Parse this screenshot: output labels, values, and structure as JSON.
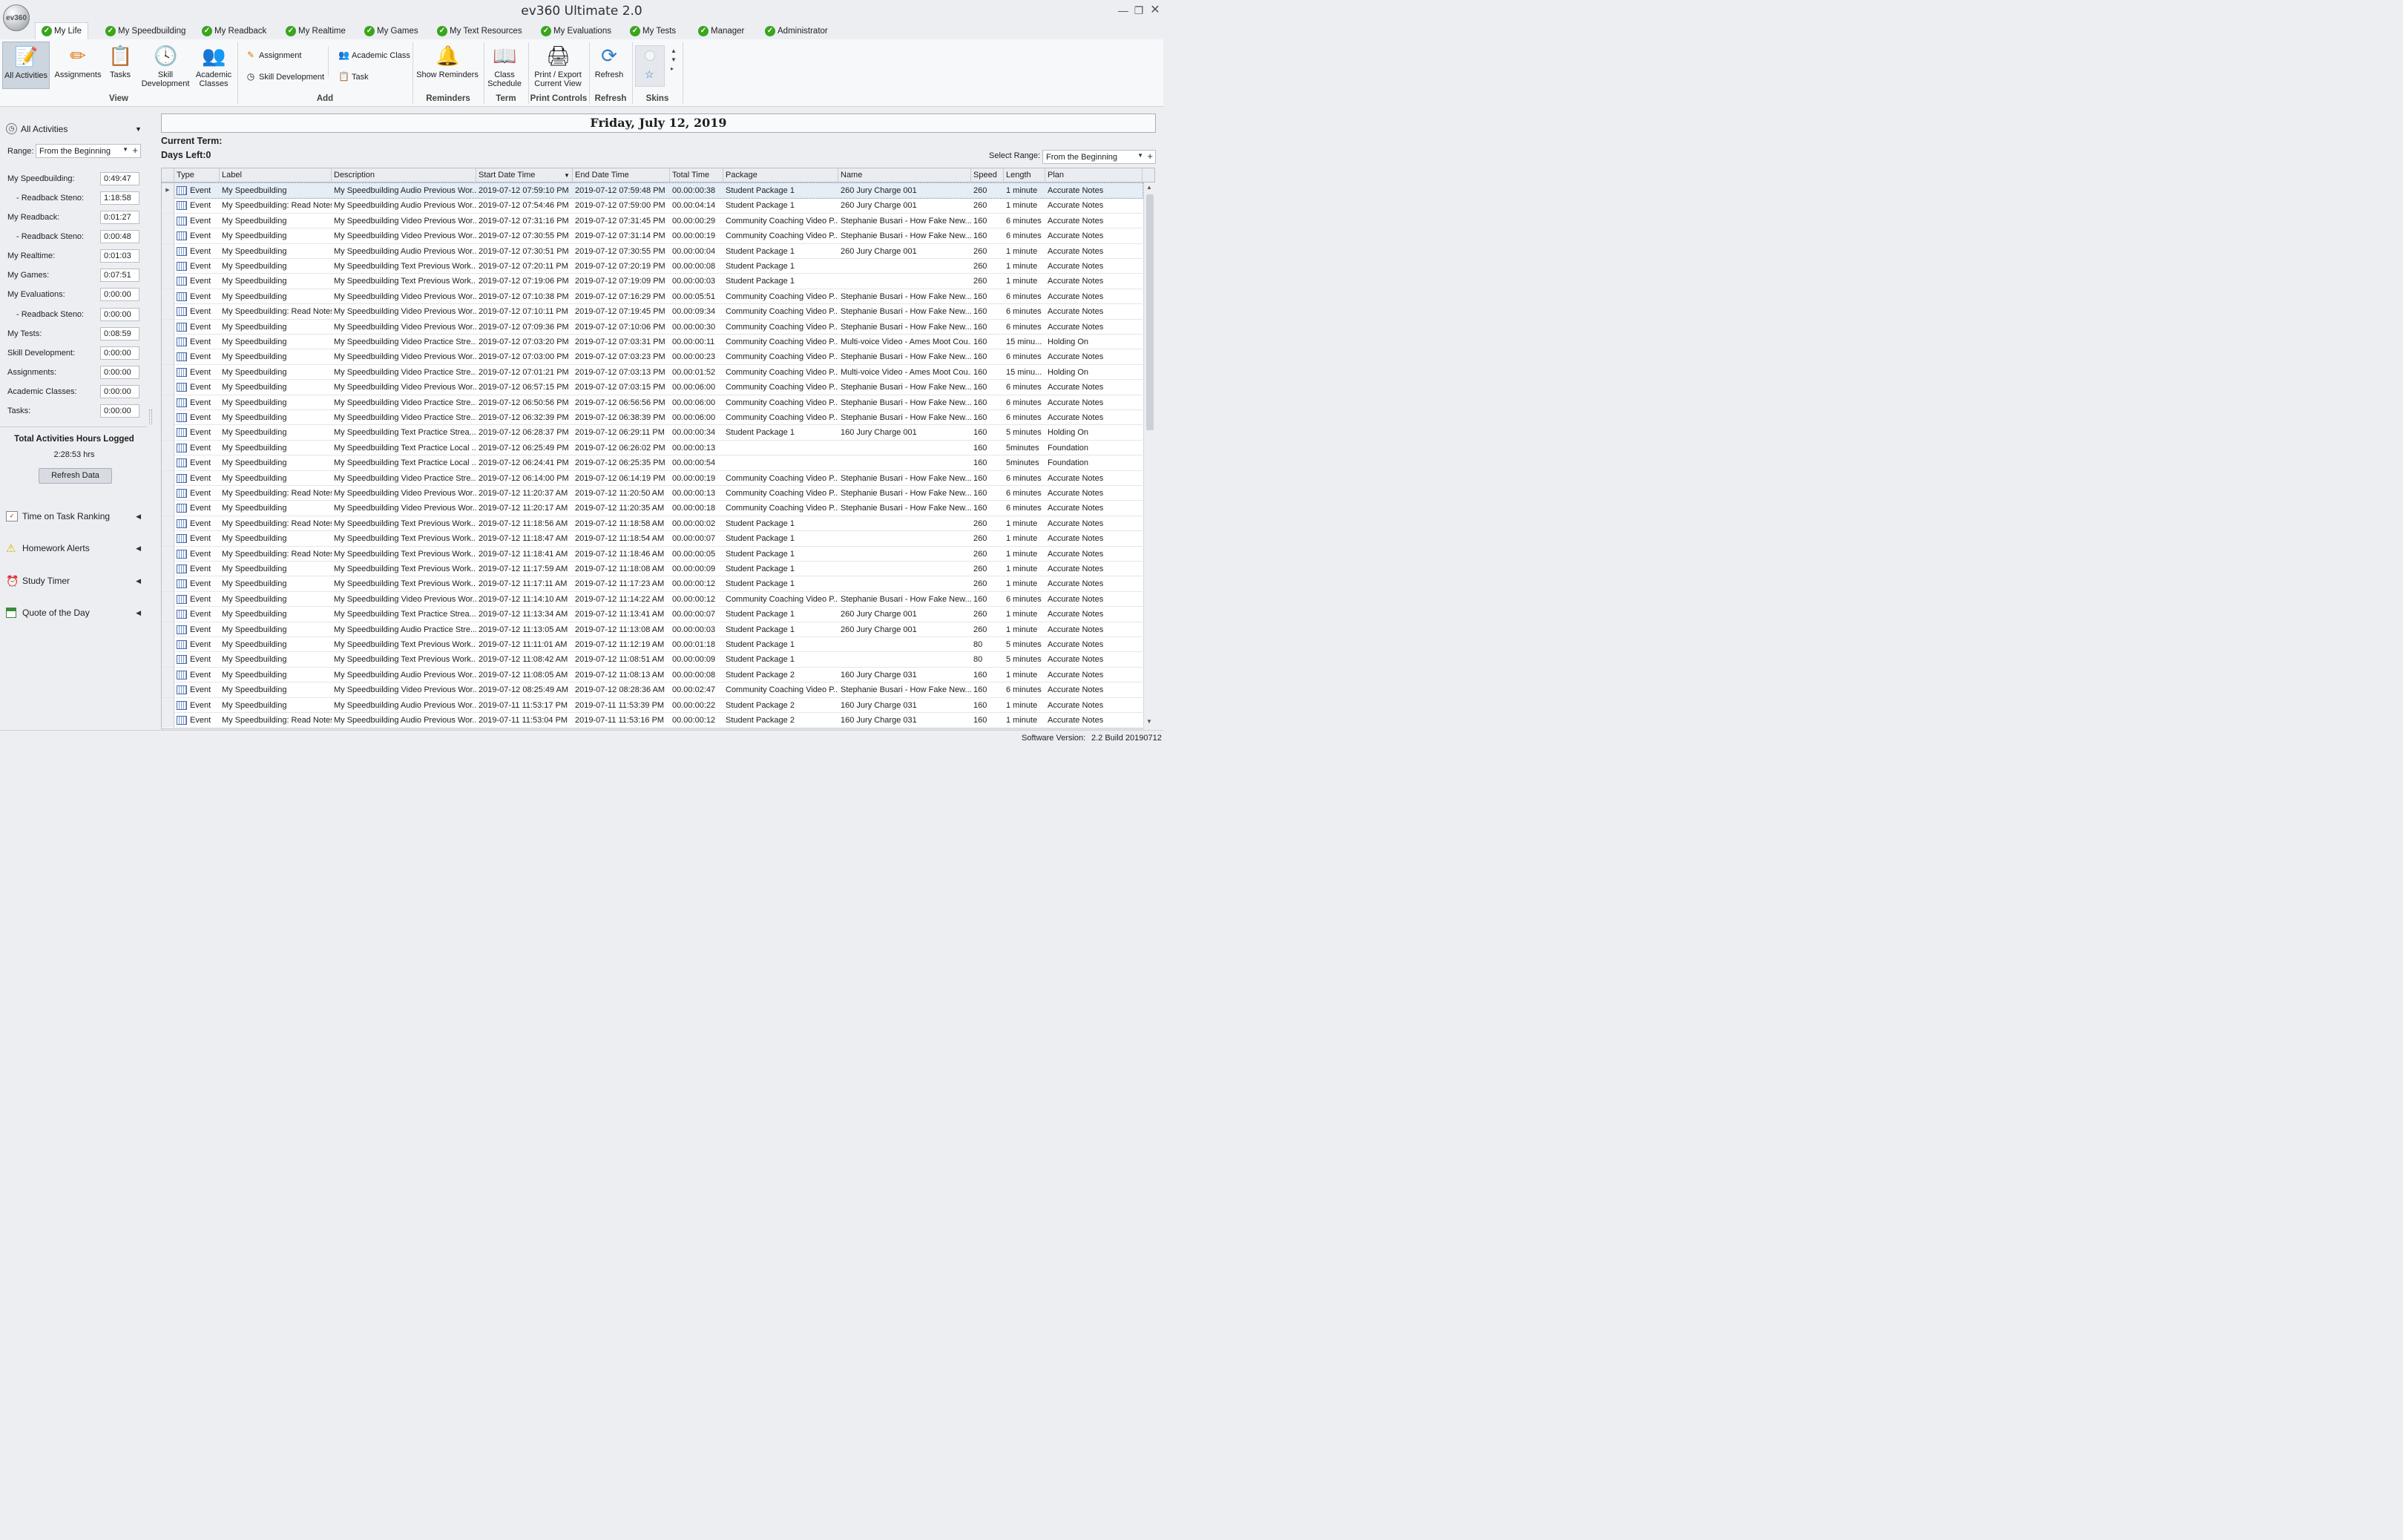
{
  "app": {
    "title": "ev360 Ultimate 2.0",
    "logo_text": "ev360"
  },
  "tabs": [
    "My Life",
    "My Speedbuilding",
    "My Readback",
    "My Realtime",
    "My Games",
    "My Text Resources",
    "My Evaluations",
    "My Tests",
    "Manager",
    "Administrator"
  ],
  "ribbon": {
    "view": {
      "label": "View",
      "all_activities": "All Activities",
      "assignments": "Assignments",
      "tasks": "Tasks",
      "skill_dev_1": "Skill",
      "skill_dev_2": "Development",
      "academic_1": "Academic",
      "academic_2": "Classes"
    },
    "add": {
      "label": "Add",
      "assignment": "Assignment",
      "skill_development": "Skill Development",
      "academic_class": "Academic Class",
      "task": "Task"
    },
    "reminders": {
      "label": "Reminders",
      "show": "Show Reminders"
    },
    "term": {
      "label": "Term",
      "class_1": "Class",
      "class_2": "Schedule"
    },
    "print": {
      "label": "Print Controls",
      "line1": "Print / Export",
      "line2": "Current View"
    },
    "refresh": {
      "label": "Refresh",
      "button": "Refresh"
    },
    "skins": {
      "label": "Skins"
    }
  },
  "sidebar": {
    "header": "All Activities",
    "range_label": "Range:",
    "range_value": "From the Beginning",
    "stats": [
      {
        "label": "My Speedbuilding:",
        "value": "0:49:47"
      },
      {
        "label": "- Readback Steno:",
        "value": "1:18:58"
      },
      {
        "label": "My Readback:",
        "value": "0:01:27"
      },
      {
        "label": "- Readback Steno:",
        "value": "0:00:48"
      },
      {
        "label": "My Realtime:",
        "value": "0:01:03"
      },
      {
        "label": "My Games:",
        "value": "0:07:51"
      },
      {
        "label": "My Evaluations:",
        "value": "0:00:00"
      },
      {
        "label": "- Readback Steno:",
        "value": "0:00:00"
      },
      {
        "label": "My Tests:",
        "value": "0:08:59"
      },
      {
        "label": "Skill Development:",
        "value": "0:00:00"
      },
      {
        "label": "Assignments:",
        "value": "0:00:00"
      },
      {
        "label": "Academic Classes:",
        "value": "0:00:00"
      },
      {
        "label": "Tasks:",
        "value": "0:00:00"
      }
    ],
    "total_label": "Total Activities Hours Logged",
    "total_value": "2:28:53 hrs",
    "refresh_button": "Refresh Data",
    "sections": [
      "Time on Task Ranking",
      "Homework Alerts",
      "Study Timer",
      "Quote of the Day"
    ]
  },
  "main": {
    "date": "Friday, July 12, 2019",
    "current_term": "Current Term:",
    "days_left": "Days Left:0",
    "select_range_label": "Select Range:",
    "select_range_value": "From the Beginning"
  },
  "grid": {
    "columns": [
      "Type",
      "Label",
      "Description",
      "Start Date Time",
      "End Date Time",
      "Total Time",
      "Package",
      "Name",
      "Speed",
      "Length",
      "Plan"
    ],
    "rows": [
      [
        "Event",
        "My Speedbuilding",
        "My Speedbuilding Audio Previous Wor...",
        "2019-07-12 07:59:10 PM",
        "2019-07-12 07:59:48 PM",
        "00.00:00:38",
        "Student Package 1",
        "260 Jury Charge 001",
        "260",
        "1 minute",
        "Accurate Notes"
      ],
      [
        "Event",
        "My Speedbuilding: Read Notes",
        "My Speedbuilding Audio Previous Wor...",
        "2019-07-12 07:54:46 PM",
        "2019-07-12 07:59:00 PM",
        "00.00:04:14",
        "Student Package 1",
        "260 Jury Charge 001",
        "260",
        "1 minute",
        "Accurate Notes"
      ],
      [
        "Event",
        "My Speedbuilding",
        "My Speedbuilding Video Previous Wor...",
        "2019-07-12 07:31:16 PM",
        "2019-07-12 07:31:45 PM",
        "00.00:00:29",
        "Community Coaching Video P...",
        "Stephanie Busari - How Fake New...",
        "160",
        "6 minutes",
        "Accurate Notes"
      ],
      [
        "Event",
        "My Speedbuilding",
        "My Speedbuilding Video Previous Wor...",
        "2019-07-12 07:30:55 PM",
        "2019-07-12 07:31:14 PM",
        "00.00:00:19",
        "Community Coaching Video P...",
        "Stephanie Busari - How Fake New...",
        "160",
        "6 minutes",
        "Accurate Notes"
      ],
      [
        "Event",
        "My Speedbuilding",
        "My Speedbuilding Audio Previous Wor...",
        "2019-07-12 07:30:51 PM",
        "2019-07-12 07:30:55 PM",
        "00.00:00:04",
        "Student Package 1",
        "260 Jury Charge 001",
        "260",
        "1 minute",
        "Accurate Notes"
      ],
      [
        "Event",
        "My Speedbuilding",
        "My Speedbuilding Text Previous Work...",
        "2019-07-12 07:20:11 PM",
        "2019-07-12 07:20:19 PM",
        "00.00:00:08",
        "Student Package 1",
        "",
        "260",
        "1 minute",
        "Accurate Notes"
      ],
      [
        "Event",
        "My Speedbuilding",
        "My Speedbuilding Text Previous Work...",
        "2019-07-12 07:19:06 PM",
        "2019-07-12 07:19:09 PM",
        "00.00:00:03",
        "Student Package 1",
        "",
        "260",
        "1 minute",
        "Accurate Notes"
      ],
      [
        "Event",
        "My Speedbuilding",
        "My Speedbuilding Video Previous Wor...",
        "2019-07-12 07:10:38 PM",
        "2019-07-12 07:16:29 PM",
        "00.00:05:51",
        "Community Coaching Video P...",
        "Stephanie Busari - How Fake New...",
        "160",
        "6 minutes",
        "Accurate Notes"
      ],
      [
        "Event",
        "My Speedbuilding: Read Notes",
        "My Speedbuilding Video Previous Wor...",
        "2019-07-12 07:10:11 PM",
        "2019-07-12 07:19:45 PM",
        "00.00:09:34",
        "Community Coaching Video P...",
        "Stephanie Busari - How Fake New...",
        "160",
        "6 minutes",
        "Accurate Notes"
      ],
      [
        "Event",
        "My Speedbuilding",
        "My Speedbuilding Video Previous Wor...",
        "2019-07-12 07:09:36 PM",
        "2019-07-12 07:10:06 PM",
        "00.00:00:30",
        "Community Coaching Video P...",
        "Stephanie Busari - How Fake New...",
        "160",
        "6 minutes",
        "Accurate Notes"
      ],
      [
        "Event",
        "My Speedbuilding",
        "My Speedbuilding Video Practice Stre...",
        "2019-07-12 07:03:20 PM",
        "2019-07-12 07:03:31 PM",
        "00.00:00:11",
        "Community Coaching Video P...",
        "Multi-voice Video - Ames Moot Cou...",
        "160",
        "15 minu...",
        "Holding On"
      ],
      [
        "Event",
        "My Speedbuilding",
        "My Speedbuilding Video Previous Wor...",
        "2019-07-12 07:03:00 PM",
        "2019-07-12 07:03:23 PM",
        "00.00:00:23",
        "Community Coaching Video P...",
        "Stephanie Busari - How Fake New...",
        "160",
        "6 minutes",
        "Accurate Notes"
      ],
      [
        "Event",
        "My Speedbuilding",
        "My Speedbuilding Video Practice Stre...",
        "2019-07-12 07:01:21 PM",
        "2019-07-12 07:03:13 PM",
        "00.00:01:52",
        "Community Coaching Video P...",
        "Multi-voice Video - Ames Moot Cou...",
        "160",
        "15 minu...",
        "Holding On"
      ],
      [
        "Event",
        "My Speedbuilding",
        "My Speedbuilding Video Previous Wor...",
        "2019-07-12 06:57:15 PM",
        "2019-07-12 07:03:15 PM",
        "00.00:06:00",
        "Community Coaching Video P...",
        "Stephanie Busari - How Fake New...",
        "160",
        "6 minutes",
        "Accurate Notes"
      ],
      [
        "Event",
        "My Speedbuilding",
        "My Speedbuilding Video Practice Stre...",
        "2019-07-12 06:50:56 PM",
        "2019-07-12 06:56:56 PM",
        "00.00:06:00",
        "Community Coaching Video P...",
        "Stephanie Busari - How Fake New...",
        "160",
        "6 minutes",
        "Accurate Notes"
      ],
      [
        "Event",
        "My Speedbuilding",
        "My Speedbuilding Video Practice Stre...",
        "2019-07-12 06:32:39 PM",
        "2019-07-12 06:38:39 PM",
        "00.00:06:00",
        "Community Coaching Video P...",
        "Stephanie Busari - How Fake New...",
        "160",
        "6 minutes",
        "Accurate Notes"
      ],
      [
        "Event",
        "My Speedbuilding",
        "My Speedbuilding Text Practice Strea...",
        "2019-07-12 06:28:37 PM",
        "2019-07-12 06:29:11 PM",
        "00.00:00:34",
        "Student Package 1",
        "160 Jury Charge 001",
        "160",
        "5 minutes",
        "Holding On"
      ],
      [
        "Event",
        "My Speedbuilding",
        "My Speedbuilding Text Practice Local ...",
        "2019-07-12 06:25:49 PM",
        "2019-07-12 06:26:02 PM",
        "00.00:00:13",
        "",
        "",
        "160",
        "5minutes",
        "Foundation"
      ],
      [
        "Event",
        "My Speedbuilding",
        "My Speedbuilding Text Practice Local ...",
        "2019-07-12 06:24:41 PM",
        "2019-07-12 06:25:35 PM",
        "00.00:00:54",
        "",
        "",
        "160",
        "5minutes",
        "Foundation"
      ],
      [
        "Event",
        "My Speedbuilding",
        "My Speedbuilding Video Practice Stre...",
        "2019-07-12 06:14:00 PM",
        "2019-07-12 06:14:19 PM",
        "00.00:00:19",
        "Community Coaching Video P...",
        "Stephanie Busari - How Fake New...",
        "160",
        "6 minutes",
        "Accurate Notes"
      ],
      [
        "Event",
        "My Speedbuilding: Read Notes",
        "My Speedbuilding Video Previous Wor...",
        "2019-07-12 11:20:37 AM",
        "2019-07-12 11:20:50 AM",
        "00.00:00:13",
        "Community Coaching Video P...",
        "Stephanie Busari - How Fake New...",
        "160",
        "6 minutes",
        "Accurate Notes"
      ],
      [
        "Event",
        "My Speedbuilding",
        "My Speedbuilding Video Previous Wor...",
        "2019-07-12 11:20:17 AM",
        "2019-07-12 11:20:35 AM",
        "00.00:00:18",
        "Community Coaching Video P...",
        "Stephanie Busari - How Fake New...",
        "160",
        "6 minutes",
        "Accurate Notes"
      ],
      [
        "Event",
        "My Speedbuilding: Read Notes",
        "My Speedbuilding Text Previous Work...",
        "2019-07-12 11:18:56 AM",
        "2019-07-12 11:18:58 AM",
        "00.00:00:02",
        "Student Package 1",
        "",
        "260",
        "1 minute",
        "Accurate Notes"
      ],
      [
        "Event",
        "My Speedbuilding",
        "My Speedbuilding Text Previous Work...",
        "2019-07-12 11:18:47 AM",
        "2019-07-12 11:18:54 AM",
        "00.00:00:07",
        "Student Package 1",
        "",
        "260",
        "1 minute",
        "Accurate Notes"
      ],
      [
        "Event",
        "My Speedbuilding: Read Notes",
        "My Speedbuilding Text Previous Work...",
        "2019-07-12 11:18:41 AM",
        "2019-07-12 11:18:46 AM",
        "00.00:00:05",
        "Student Package 1",
        "",
        "260",
        "1 minute",
        "Accurate Notes"
      ],
      [
        "Event",
        "My Speedbuilding",
        "My Speedbuilding Text Previous Work...",
        "2019-07-12 11:17:59 AM",
        "2019-07-12 11:18:08 AM",
        "00.00:00:09",
        "Student Package 1",
        "",
        "260",
        "1 minute",
        "Accurate Notes"
      ],
      [
        "Event",
        "My Speedbuilding",
        "My Speedbuilding Text Previous Work...",
        "2019-07-12 11:17:11 AM",
        "2019-07-12 11:17:23 AM",
        "00.00:00:12",
        "Student Package 1",
        "",
        "260",
        "1 minute",
        "Accurate Notes"
      ],
      [
        "Event",
        "My Speedbuilding",
        "My Speedbuilding Video Previous Wor...",
        "2019-07-12 11:14:10 AM",
        "2019-07-12 11:14:22 AM",
        "00.00:00:12",
        "Community Coaching Video P...",
        "Stephanie Busari - How Fake New...",
        "160",
        "6 minutes",
        "Accurate Notes"
      ],
      [
        "Event",
        "My Speedbuilding",
        "My Speedbuilding Text Practice Strea...",
        "2019-07-12 11:13:34 AM",
        "2019-07-12 11:13:41 AM",
        "00.00:00:07",
        "Student Package 1",
        "260 Jury Charge 001",
        "260",
        "1 minute",
        "Accurate Notes"
      ],
      [
        "Event",
        "My Speedbuilding",
        "My Speedbuilding Audio Practice Stre...",
        "2019-07-12 11:13:05 AM",
        "2019-07-12 11:13:08 AM",
        "00.00:00:03",
        "Student Package 1",
        "260 Jury Charge 001",
        "260",
        "1 minute",
        "Accurate Notes"
      ],
      [
        "Event",
        "My Speedbuilding",
        "My Speedbuilding Text Previous Work...",
        "2019-07-12 11:11:01 AM",
        "2019-07-12 11:12:19 AM",
        "00.00:01:18",
        "Student Package 1",
        "",
        "80",
        "5 minutes",
        "Accurate Notes"
      ],
      [
        "Event",
        "My Speedbuilding",
        "My Speedbuilding Text Previous Work...",
        "2019-07-12 11:08:42 AM",
        "2019-07-12 11:08:51 AM",
        "00.00:00:09",
        "Student Package 1",
        "",
        "80",
        "5 minutes",
        "Accurate Notes"
      ],
      [
        "Event",
        "My Speedbuilding",
        "My Speedbuilding Audio Previous Wor...",
        "2019-07-12 11:08:05 AM",
        "2019-07-12 11:08:13 AM",
        "00.00:00:08",
        "Student Package 2",
        "160 Jury Charge 031",
        "160",
        "1 minute",
        "Accurate Notes"
      ],
      [
        "Event",
        "My Speedbuilding",
        "My Speedbuilding Video Previous Wor...",
        "2019-07-12 08:25:49 AM",
        "2019-07-12 08:28:36 AM",
        "00.00:02:47",
        "Community Coaching Video P...",
        "Stephanie Busari - How Fake New...",
        "160",
        "6 minutes",
        "Accurate Notes"
      ],
      [
        "Event",
        "My Speedbuilding",
        "My Speedbuilding Audio Previous Wor...",
        "2019-07-11 11:53:17 PM",
        "2019-07-11 11:53:39 PM",
        "00.00:00:22",
        "Student Package 2",
        "160 Jury Charge 031",
        "160",
        "1 minute",
        "Accurate Notes"
      ],
      [
        "Event",
        "My Speedbuilding: Read Notes",
        "My Speedbuilding Audio Previous Wor...",
        "2019-07-11 11:53:04 PM",
        "2019-07-11 11:53:16 PM",
        "00.00:00:12",
        "Student Package 2",
        "160 Jury Charge 031",
        "160",
        "1 minute",
        "Accurate Notes"
      ]
    ]
  },
  "status": {
    "label": "Software Version:",
    "value": "2.2 Build 20190712"
  },
  "colors": {
    "accent_green": "#3aa51d",
    "selection": "#e5edf7",
    "background": "#eceef2"
  },
  "icons": {
    "minimize": "minimize-icon",
    "maximize": "maximize-icon",
    "close": "close-icon"
  }
}
